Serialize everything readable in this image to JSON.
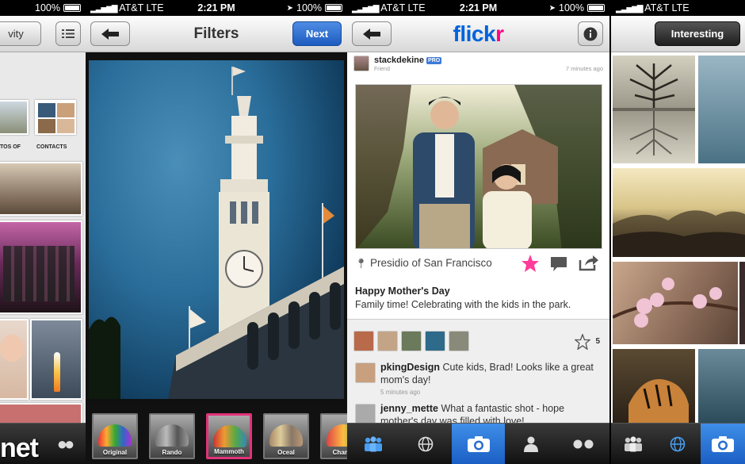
{
  "status": {
    "carrier": "AT&T",
    "network": "LTE",
    "time": "2:21 PM",
    "battery": "100%"
  },
  "panel1": {
    "back_label": "vity",
    "captions": [
      "TOS OF",
      "CONTACTS"
    ],
    "watermark": "net"
  },
  "panel2": {
    "title": "Filters",
    "next_label": "Next",
    "filters": [
      "Original",
      "Rando",
      "Mammoth",
      "Oceal",
      "Chame"
    ]
  },
  "panel3": {
    "logo_a": "flick",
    "logo_b": "r",
    "user": "stackdekine",
    "pro_badge": "PRO",
    "sub": "Friend",
    "ago": "7 minutes ago",
    "location": "Presidio of San Francisco",
    "title": "Happy Mother's Day",
    "description": "Family time! Celebrating with the kids in the park.",
    "fav_count": "5",
    "comments": [
      {
        "name": "pkingDesign",
        "text": "Cute kids, Brad! Looks like a great mom's day!",
        "ago": "5 minutes ago"
      },
      {
        "name": "jenny_mette",
        "text": "What a fantastic shot - hope mother's day was filled with love!",
        "ago": ""
      }
    ]
  },
  "panel4": {
    "segment_label": "Interesting"
  },
  "colors": {
    "flickr_blue": "#0063dc",
    "flickr_pink": "#ff0084",
    "ios_blue": "#1d5cc0",
    "filter_selected": "#e2327a"
  }
}
